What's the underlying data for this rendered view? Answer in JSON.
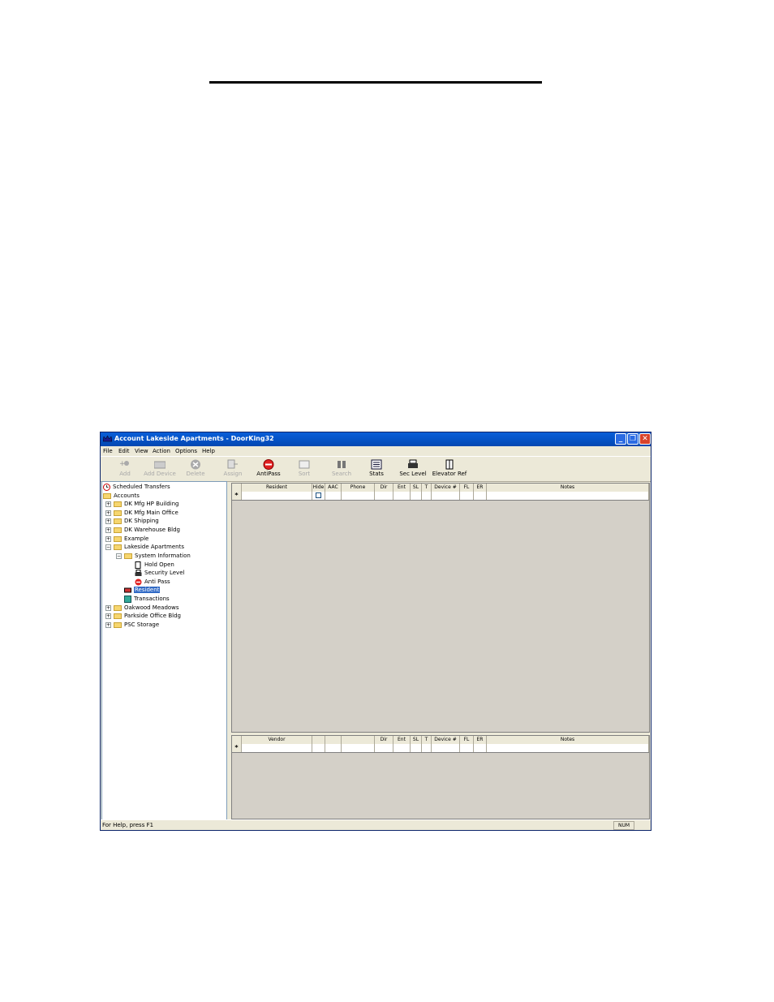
{
  "window": {
    "title": "Account Lakeside Apartments - DoorKing32",
    "minimize": "_",
    "restore": "❐",
    "close": "✕"
  },
  "menu": [
    "File",
    "Edit",
    "View",
    "Action",
    "Options",
    "Help"
  ],
  "toolbar": [
    {
      "label": "Add",
      "icon": "add-icon",
      "enabled": false
    },
    {
      "label": "Add Device",
      "icon": "add-device-icon",
      "enabled": false
    },
    {
      "label": "Delete",
      "icon": "delete-icon",
      "enabled": false
    },
    {
      "label": "Assign",
      "icon": "assign-icon",
      "enabled": false
    },
    {
      "label": "AntiPass",
      "icon": "antipass-icon",
      "enabled": true
    },
    {
      "label": "Sort",
      "icon": "sort-icon",
      "enabled": false
    },
    {
      "label": "Search",
      "icon": "binoculars-icon",
      "enabled": false
    },
    {
      "label": "Stats",
      "icon": "stats-icon",
      "enabled": true
    },
    {
      "label": "Sec Level",
      "icon": "printer-icon",
      "enabled": true
    },
    {
      "label": "Elevator Ref",
      "icon": "elevator-icon",
      "enabled": true
    }
  ],
  "tree": [
    {
      "label": "Scheduled Transfers",
      "icon": "clock-icon"
    },
    {
      "label": "Accounts",
      "icon": "open-folder-icon"
    },
    {
      "label": "DK Mfg HP Building",
      "icon": "folder-icon",
      "exp": "+"
    },
    {
      "label": "DK Mfg Main Office",
      "icon": "folder-icon",
      "exp": "+"
    },
    {
      "label": "DK Shipping",
      "icon": "folder-icon",
      "exp": "+"
    },
    {
      "label": "DK Warehouse Bldg",
      "icon": "folder-icon",
      "exp": "+"
    },
    {
      "label": "Example",
      "icon": "folder-icon",
      "exp": "+"
    },
    {
      "label": "Lakeside Apartments",
      "icon": "open-folder-icon",
      "exp": "-"
    },
    {
      "label": "System Information",
      "icon": "open-folder-icon",
      "exp": "-"
    },
    {
      "label": "Hold Open",
      "icon": "door-icon"
    },
    {
      "label": "Security Level",
      "icon": "printer-icon"
    },
    {
      "label": "Anti Pass",
      "icon": "antipass-icon"
    },
    {
      "label": "Resident",
      "icon": "resident-icon",
      "selected": true
    },
    {
      "label": "Transactions",
      "icon": "transactions-icon"
    },
    {
      "label": "Oakwood Meadows",
      "icon": "folder-icon",
      "exp": "+"
    },
    {
      "label": "Parkside Office Bldg",
      "icon": "folder-icon",
      "exp": "+"
    },
    {
      "label": "PSC Storage",
      "icon": "folder-icon",
      "exp": "+"
    }
  ],
  "resident_grid": {
    "columns": [
      "Resident",
      "Hide",
      "AAC",
      "Phone",
      "Dir",
      "Ent",
      "SL",
      "T",
      "Device #",
      "FL",
      "ER",
      "Notes"
    ],
    "new_row_marker": "*"
  },
  "vendor_grid": {
    "columns": [
      "Vendor",
      "",
      "",
      "",
      "Dir",
      "Ent",
      "SL",
      "T",
      "Device #",
      "FL",
      "ER",
      "Notes"
    ],
    "new_row_marker": "*"
  },
  "status": {
    "help": "For Help, press F1",
    "num": "NUM"
  }
}
